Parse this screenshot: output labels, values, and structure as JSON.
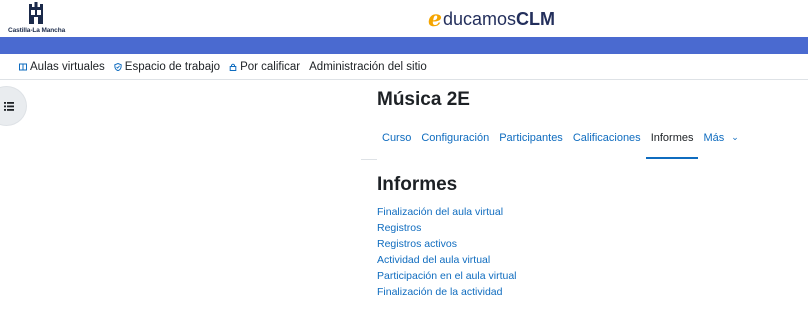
{
  "header": {
    "org_logo_text": "Castilla-La Mancha",
    "brand": {
      "e": "e",
      "rest": "ducamos",
      "clm": "CLM"
    },
    "colors": {
      "brand_orange": "#f5a500",
      "brand_navy": "#232f5c",
      "bluebar": "#4a6ad0",
      "link": "#0f6cbf"
    }
  },
  "primary_nav": [
    {
      "label": "Aulas virtuales",
      "icon": "grid-icon"
    },
    {
      "label": "Espacio de trabajo",
      "icon": "shield-icon"
    },
    {
      "label": "Por calificar",
      "icon": "lock-icon"
    },
    {
      "label": "Administración del sitio",
      "icon": ""
    }
  ],
  "drawer_toggle": {
    "icon": "list-icon"
  },
  "course": {
    "title": "Música 2E"
  },
  "secondary_nav": [
    {
      "label": "Curso",
      "active": false
    },
    {
      "label": "Configuración",
      "active": false
    },
    {
      "label": "Participantes",
      "active": false
    },
    {
      "label": "Calificaciones",
      "active": false
    },
    {
      "label": "Informes",
      "active": true
    },
    {
      "label": "Más",
      "active": false,
      "icon": "chevron-down-icon"
    }
  ],
  "reports": {
    "title": "Informes",
    "links": [
      "Finalización del aula virtual",
      "Registros",
      "Registros activos",
      "Actividad del aula virtual",
      "Participación en el aula virtual",
      "Finalización de la actividad"
    ]
  }
}
